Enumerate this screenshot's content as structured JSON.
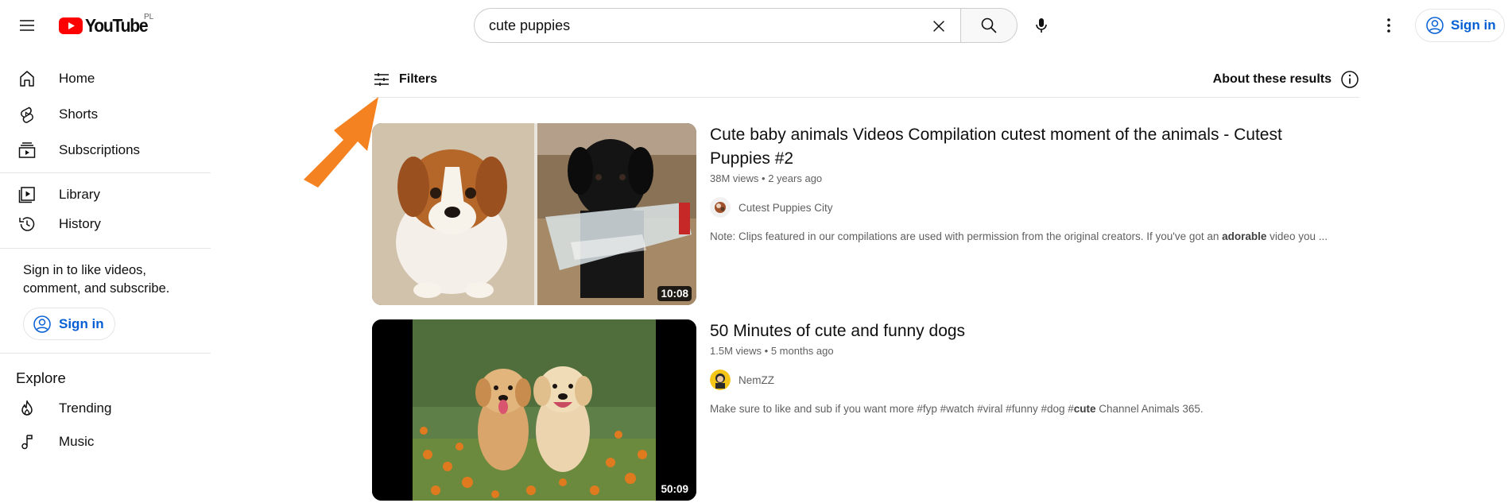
{
  "header": {
    "logo_text": "YouTube",
    "country_code": "PL",
    "search": {
      "value": "cute puppies",
      "placeholder": "Search"
    },
    "sign_in_label": "Sign in"
  },
  "sidebar": {
    "items_main": [
      {
        "label": "Home",
        "icon": "home-icon"
      },
      {
        "label": "Shorts",
        "icon": "shorts-icon"
      },
      {
        "label": "Subscriptions",
        "icon": "subscriptions-icon"
      }
    ],
    "items_you": [
      {
        "label": "Library",
        "icon": "library-icon"
      },
      {
        "label": "History",
        "icon": "history-icon"
      }
    ],
    "signin_prompt": "Sign in to like videos, comment, and subscribe.",
    "sign_in_label": "Sign in",
    "explore_title": "Explore",
    "items_explore": [
      {
        "label": "Trending",
        "icon": "trending-icon"
      },
      {
        "label": "Music",
        "icon": "music-icon"
      }
    ]
  },
  "filters": {
    "label": "Filters",
    "about_label": "About these results"
  },
  "results": [
    {
      "title": "Cute baby animals Videos Compilation cutest moment of the animals - Cutest Puppies #2",
      "views": "38M views",
      "age": "2 years ago",
      "channel": "Cutest Puppies City",
      "duration": "10:08",
      "desc_before": "Note: Clips featured in our compilations are used with permission from the original creators. If you've got an ",
      "desc_bold": "adorable",
      "desc_after": " video you ..."
    },
    {
      "title": "50 Minutes of cute and funny dogs",
      "views": "1.5M views",
      "age": "5 months ago",
      "channel": "NemZZ",
      "duration": "50:09",
      "desc_before": "Make sure to like and sub if you want more #fyp #watch #viral #funny #dog #",
      "desc_bold": "cute",
      "desc_after": " Channel Animals 365."
    }
  ],
  "colors": {
    "brand_red": "#ff0000",
    "link_blue": "#065fd4",
    "annotation_arrow": "#f58220"
  }
}
